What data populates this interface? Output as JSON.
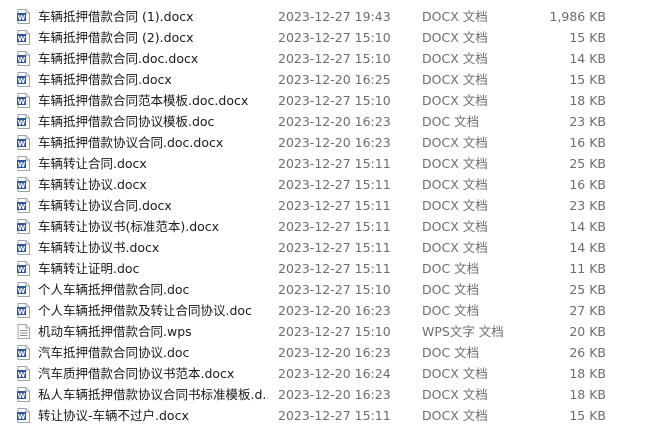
{
  "colors": {
    "word_blue": "#2b579a",
    "wps_gray": "#8a8a8a",
    "meta_text": "#6d6d6d"
  },
  "files": [
    {
      "name": "车辆抵押借款合同 (1).docx",
      "date": "2023-12-27 19:43",
      "type": "DOCX 文档",
      "size": "1,986 KB",
      "icon": "word-doc-icon"
    },
    {
      "name": "车辆抵押借款合同 (2).docx",
      "date": "2023-12-27 15:10",
      "type": "DOCX 文档",
      "size": "15 KB",
      "icon": "word-doc-icon"
    },
    {
      "name": "车辆抵押借款合同.doc.docx",
      "date": "2023-12-27 15:10",
      "type": "DOCX 文档",
      "size": "14 KB",
      "icon": "word-doc-icon"
    },
    {
      "name": "车辆抵押借款合同.docx",
      "date": "2023-12-20 16:25",
      "type": "DOCX 文档",
      "size": "15 KB",
      "icon": "word-doc-icon"
    },
    {
      "name": "车辆抵押借款合同范本模板.doc.docx",
      "date": "2023-12-27 15:10",
      "type": "DOCX 文档",
      "size": "18 KB",
      "icon": "word-doc-icon"
    },
    {
      "name": "车辆抵押借款合同协议模板.doc",
      "date": "2023-12-20 16:23",
      "type": "DOC 文档",
      "size": "23 KB",
      "icon": "word-doc-icon"
    },
    {
      "name": "车辆抵押借款协议合同.doc.docx",
      "date": "2023-12-20 16:23",
      "type": "DOCX 文档",
      "size": "16 KB",
      "icon": "word-doc-icon"
    },
    {
      "name": "车辆转让合同.docx",
      "date": "2023-12-27 15:11",
      "type": "DOCX 文档",
      "size": "25 KB",
      "icon": "word-doc-icon"
    },
    {
      "name": "车辆转让协议.docx",
      "date": "2023-12-27 15:11",
      "type": "DOCX 文档",
      "size": "16 KB",
      "icon": "word-doc-icon"
    },
    {
      "name": "车辆转让协议合同.docx",
      "date": "2023-12-27 15:11",
      "type": "DOCX 文档",
      "size": "23 KB",
      "icon": "word-doc-icon"
    },
    {
      "name": "车辆转让协议书(标准范本).docx",
      "date": "2023-12-27 15:11",
      "type": "DOCX 文档",
      "size": "14 KB",
      "icon": "word-doc-icon"
    },
    {
      "name": "车辆转让协议书.docx",
      "date": "2023-12-27 15:11",
      "type": "DOCX 文档",
      "size": "14 KB",
      "icon": "word-doc-icon"
    },
    {
      "name": "车辆转让证明.doc",
      "date": "2023-12-27 15:11",
      "type": "DOC 文档",
      "size": "11 KB",
      "icon": "word-doc-icon"
    },
    {
      "name": "个人车辆抵押借款合同.doc",
      "date": "2023-12-27 15:10",
      "type": "DOC 文档",
      "size": "25 KB",
      "icon": "word-doc-icon"
    },
    {
      "name": "个人车辆抵押借款及转让合同协议.doc",
      "date": "2023-12-20 16:23",
      "type": "DOC 文档",
      "size": "27 KB",
      "icon": "word-doc-icon"
    },
    {
      "name": "机动车辆抵押借款合同.wps",
      "date": "2023-12-27 15:10",
      "type": "WPS文字 文档",
      "size": "20 KB",
      "icon": "wps-doc-icon"
    },
    {
      "name": "汽车抵押借款合同协议.doc",
      "date": "2023-12-20 16:23",
      "type": "DOC 文档",
      "size": "26 KB",
      "icon": "word-doc-icon"
    },
    {
      "name": "汽车质押借款合同协议书范本.docx",
      "date": "2023-12-20 16:24",
      "type": "DOCX 文档",
      "size": "18 KB",
      "icon": "word-doc-icon"
    },
    {
      "name": "私人车辆抵押借款协议合同书标准模板.d...",
      "date": "2023-12-20 16:23",
      "type": "DOCX 文档",
      "size": "18 KB",
      "icon": "word-doc-icon"
    },
    {
      "name": "转让协议-车辆不过户.docx",
      "date": "2023-12-27 15:11",
      "type": "DOCX 文档",
      "size": "15 KB",
      "icon": "word-doc-icon"
    }
  ]
}
